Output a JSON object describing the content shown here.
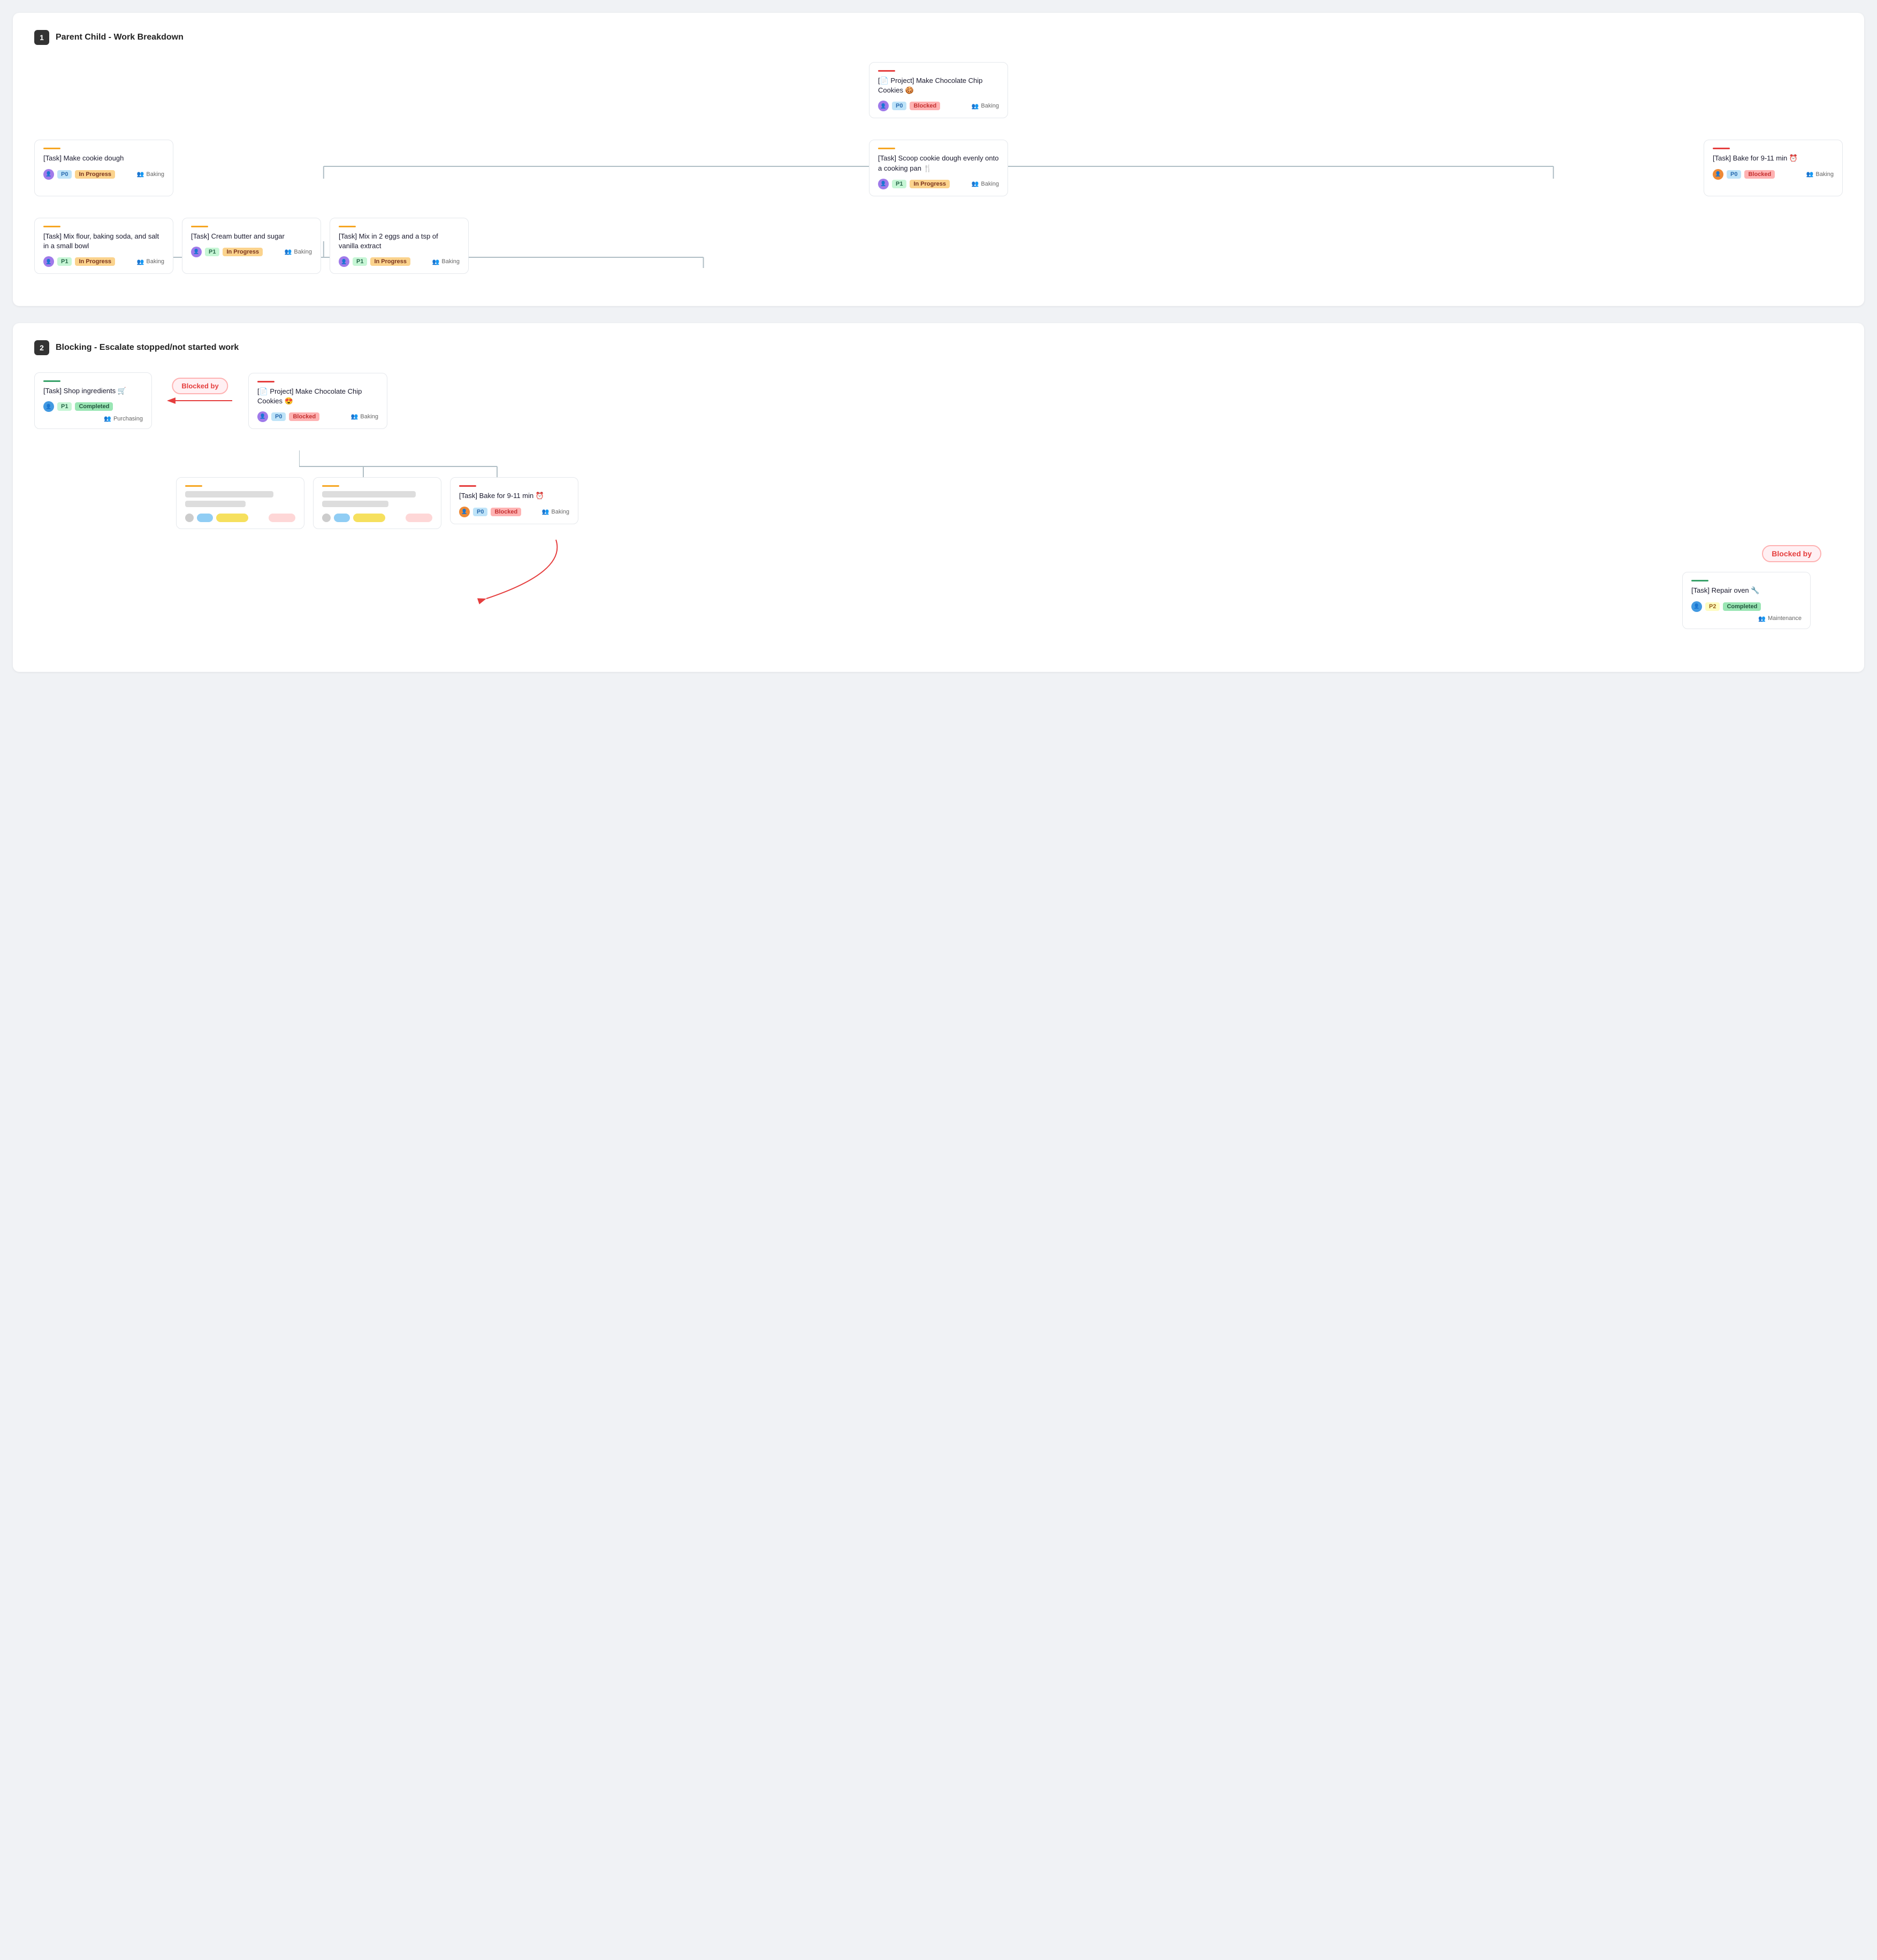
{
  "section1": {
    "number": "1",
    "title": "Parent Child - Work Breakdown",
    "root": {
      "accent": "accent-red",
      "icon": "📄",
      "title": "[📄 Project] Make Chocolate Chip Cookies 🍪",
      "avatar_class": "avatar-purple",
      "priority": "P0",
      "priority_class": "badge-p0",
      "status": "Blocked",
      "status_class": "badge-blocked",
      "team": "Baking"
    },
    "level1": [
      {
        "accent": "accent-orange",
        "title": "[Task] Make cookie dough",
        "avatar_class": "avatar-purple",
        "priority": "P0",
        "priority_class": "badge-p0",
        "status": "In Progress",
        "status_class": "badge-inprogress",
        "team": "Baking",
        "has_children": true
      },
      {
        "accent": "accent-orange",
        "title": "[Task] Scoop cookie dough evenly onto a cooking pan 🍴",
        "avatar_class": "avatar-purple",
        "priority": "P1",
        "priority_class": "badge-p1",
        "status": "In Progress",
        "status_class": "badge-inprogress",
        "team": "Baking",
        "has_children": false
      },
      {
        "accent": "accent-red",
        "title": "[Task] Bake for 9-11 min ⏰",
        "avatar_class": "avatar-orange",
        "priority": "P0",
        "priority_class": "badge-p0",
        "status": "Blocked",
        "status_class": "badge-blocked",
        "team": "Baking",
        "has_children": false
      }
    ],
    "level2": [
      {
        "accent": "accent-orange",
        "title": "[Task] Mix flour, baking soda, and salt in a small bowl",
        "avatar_class": "avatar-purple",
        "priority": "P1",
        "priority_class": "badge-p1",
        "status": "In Progress",
        "status_class": "badge-inprogress",
        "team": "Baking"
      },
      {
        "accent": "accent-orange",
        "title": "[Task] Cream butter and sugar",
        "avatar_class": "avatar-purple",
        "priority": "P1",
        "priority_class": "badge-p1",
        "status": "In Progress",
        "status_class": "badge-inprogress",
        "team": "Baking"
      },
      {
        "accent": "accent-orange",
        "title": "[Task] Mix in 2 eggs and a tsp of vanilla extract",
        "avatar_class": "avatar-purple",
        "priority": "P1",
        "priority_class": "badge-p1",
        "status": "In Progress",
        "status_class": "badge-inprogress",
        "team": "Baking"
      }
    ]
  },
  "section2": {
    "number": "2",
    "title": "Blocking - Escalate stopped/not started work",
    "shop": {
      "accent": "accent-green",
      "title": "[Task] Shop ingredients 🛒",
      "avatar_class": "avatar-blue",
      "priority": "P1",
      "priority_class": "badge-p1",
      "status": "Completed",
      "status_class": "badge-completed",
      "team": "Purchasing"
    },
    "blocked_by_label": "Blocked by",
    "root": {
      "accent": "accent-red",
      "title": "[📄 Project] Make Chocolate Chip Cookies 😍",
      "avatar_class": "avatar-purple",
      "priority": "P0",
      "priority_class": "badge-p0",
      "status": "Blocked",
      "status_class": "badge-blocked",
      "team": "Baking"
    },
    "level1_blurred": [
      {
        "accent": "accent-orange"
      },
      {
        "accent": "accent-orange"
      }
    ],
    "bake_task": {
      "accent": "accent-red",
      "title": "[Task] Bake for 9-11 min ⏰",
      "avatar_class": "avatar-orange",
      "priority": "P0",
      "priority_class": "badge-p0",
      "status": "Blocked",
      "status_class": "badge-blocked",
      "team": "Baking"
    },
    "blocked_by_label2": "Blocked by",
    "repair": {
      "accent": "accent-green",
      "title": "[Task] Repair oven 🔧",
      "avatar_class": "avatar-blue",
      "priority": "P2",
      "priority_class": "badge-p2",
      "status": "Completed",
      "status_class": "badge-completed",
      "team": "Maintenance"
    }
  }
}
